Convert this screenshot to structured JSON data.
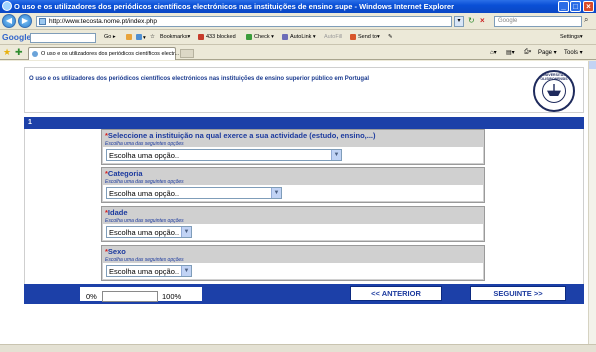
{
  "window": {
    "title": "O uso e os utilizadores dos periódicos científicos electrónicos nas instituições de ensino supe - Windows Internet Explorer"
  },
  "address_bar": {
    "url": "http://www.tecosta.nome.pt/index.php",
    "search_placeholder": "Google"
  },
  "google_toolbar": {
    "logo": "Google",
    "search_label": "G▾",
    "go": "Go ▸",
    "bookmarks": "Bookmarks▾",
    "blocked": "433 blocked",
    "check": "Check ▾",
    "autolink": "AutoLink ▾",
    "autofill": "AutoFill",
    "sendto": "Send to▾",
    "settings": "Settings▾"
  },
  "tabs": [
    {
      "label": "O uso e os utilizadores dos periódicos científicos electr..."
    }
  ],
  "command_bar": {
    "page": "Page ▾",
    "tools": "Tools ▾"
  },
  "header": {
    "title": "O uso e os utilizadores dos periódicos científicos electrónicos nas instituições de ensino superior público em Portugal"
  },
  "section": {
    "number": "1"
  },
  "questions": [
    {
      "required_mark": "*",
      "label": "Seleccione a instituição na qual exerce a sua actividade (estudo, ensino,...)",
      "hint": "Escolha uma das seguintes opções",
      "value": "Escolha uma opção.."
    },
    {
      "required_mark": "*",
      "label": "Categoria",
      "hint": "Escolha uma das seguintes opções",
      "value": "Escolha uma opção.."
    },
    {
      "required_mark": "*",
      "label": "Idade",
      "hint": "Escolha uma das seguintes opções",
      "value": "Escolha uma opção.."
    },
    {
      "required_mark": "*",
      "label": "Sexo",
      "hint": "Escolha uma das seguintes opções",
      "value": "Escolha uma opção.."
    }
  ],
  "progress": {
    "start_label": "0%",
    "end_label": "100%",
    "value_percent": 0
  },
  "navigation": {
    "previous_label": "<< ANTERIOR",
    "next_label": "SEGUINTE >>"
  },
  "colors": {
    "titlebar": "#0a4fd6",
    "section_bar": "#1c40a8",
    "question_bg": "#d0d0d0",
    "question_label": "#1c3a9e",
    "required_mark": "#d42020"
  }
}
